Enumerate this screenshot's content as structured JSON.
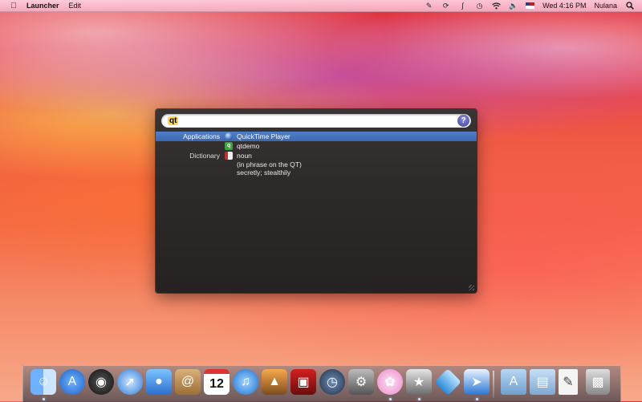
{
  "menubar": {
    "app_name": "Launcher",
    "menus": [
      "Edit"
    ],
    "clock": "Wed 4:16 PM",
    "user": "Nulana",
    "status_icons": [
      "scripts-icon",
      "sync-icon",
      "bluetooth-icon",
      "time-machine-icon",
      "wifi-icon",
      "volume-icon",
      "us-flag-icon",
      "spotlight-icon"
    ]
  },
  "launcher": {
    "search": {
      "value": "qt",
      "placeholder": ""
    },
    "help_label": "?",
    "results": [
      {
        "category": "Applications",
        "label": "QuickTime Player",
        "icon": "quicktime-icon",
        "selected": true
      },
      {
        "category": "",
        "label": "qtdemo",
        "icon": "qtdemo-icon",
        "selected": false
      },
      {
        "category": "Dictionary",
        "label": "noun",
        "icon": "dictionary-icon",
        "selected": false
      }
    ],
    "definition_lines": [
      "(in phrase on the QT)",
      "secretly; stealthily"
    ]
  },
  "dock": {
    "apps": [
      {
        "name": "finder",
        "running": true
      },
      {
        "name": "app-store",
        "running": false
      },
      {
        "name": "dashboard",
        "running": false
      },
      {
        "name": "safari",
        "running": false
      },
      {
        "name": "facetime",
        "running": false
      },
      {
        "name": "address-book",
        "running": false
      },
      {
        "name": "ical",
        "label": "12",
        "running": false
      },
      {
        "name": "itunes",
        "running": false
      },
      {
        "name": "iphoto",
        "running": false
      },
      {
        "name": "photo-booth",
        "running": false
      },
      {
        "name": "time-machine",
        "running": false
      },
      {
        "name": "system-preferences",
        "running": false
      },
      {
        "name": "flower-app",
        "running": true
      },
      {
        "name": "imovie",
        "running": true
      },
      {
        "name": "network-app",
        "running": false
      },
      {
        "name": "xcode-rocket",
        "running": true
      }
    ],
    "stacks": [
      "applications-folder",
      "documents-folder",
      "pdf-document",
      "trash"
    ]
  },
  "colors": {
    "selection": "#3b68b2",
    "window_bg": "#2e2a2a"
  }
}
